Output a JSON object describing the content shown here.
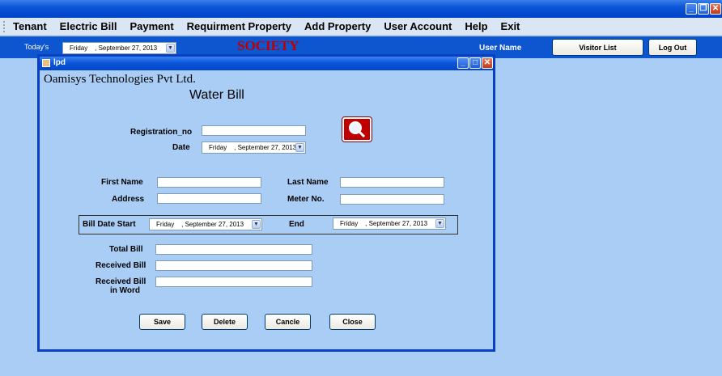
{
  "menu": [
    "Tenant",
    "Electric Bill",
    "Payment",
    "Requirment Property",
    "Add Property",
    "User Account",
    "Help",
    "Exit"
  ],
  "header": {
    "todays_label": "Today's",
    "date_value": "Friday    , September 27, 2013",
    "society_title": "SOCIETY",
    "user_name_label": "User Name",
    "visitor_list_button": "Visitor List",
    "logout_button": "Log Out"
  },
  "child_window": {
    "title": "lpd",
    "company": "Oamisys Technologies Pvt Ltd.",
    "form_title": "Water Bill"
  },
  "form": {
    "registration_label": "Registration_no",
    "registration_value": "",
    "date_label": "Date",
    "date_value": "Friday    , September 27, 2013",
    "first_name_label": "First Name",
    "first_name_value": "",
    "last_name_label": "Last Name",
    "last_name_value": "",
    "address_label": "Address",
    "address_value": "",
    "meter_label": "Meter No.",
    "meter_value": "",
    "bill_date_start_label": "Bill Date Start",
    "bill_date_start_value": "Friday    , September 27, 2013",
    "end_label": "End",
    "end_value": "Friday    , September 27, 2013",
    "total_bill_label": "Total Bill",
    "total_bill_value": "",
    "received_bill_label": "Received Bill",
    "received_bill_value": "",
    "received_word_label_1": "Received Bill",
    "received_word_label_2": "in Word",
    "received_word_value": ""
  },
  "buttons": {
    "save": "Save",
    "delete": "Delete",
    "cancel": "Cancle",
    "close": "Close"
  }
}
